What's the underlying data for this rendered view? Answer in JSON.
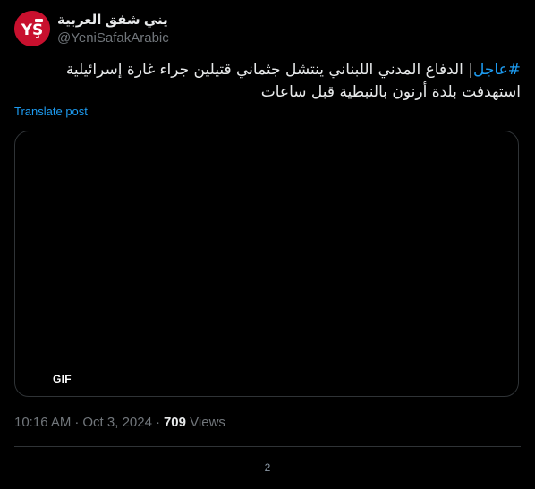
{
  "account": {
    "display_name": "يني شفق العربية",
    "handle": "@YeniSafakArabic",
    "avatar_icon": "yeni-safak-logo",
    "avatar_logo_text": "YŞ",
    "brand_color": "#c8102e"
  },
  "tweet": {
    "hashtag": "#عاجل",
    "separator": "|",
    "text": " الدفاع المدني اللبناني ينتشل جثماني قتيلين جراء غارة إسرائيلية استهدفت بلدة أرنون بالنبطية قبل ساعات",
    "translate_label": "Translate post"
  },
  "media": {
    "badge": "GIF"
  },
  "meta": {
    "time": "10:16 AM",
    "separator": "·",
    "date": "Oct 3, 2024",
    "views_count": "709",
    "views_label": "Views"
  },
  "footer": {
    "page_number": "2"
  },
  "colors": {
    "background": "#000000",
    "text_primary": "#e7e9ea",
    "text_secondary": "#71767b",
    "link": "#1d9bf0",
    "border": "#2f3336"
  }
}
